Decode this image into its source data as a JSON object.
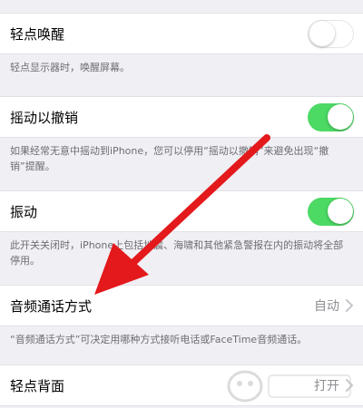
{
  "settings": {
    "tap_to_wake": {
      "label": "轻点唤醒",
      "toggle": "off",
      "footer": "轻点显示器时，唤醒屏幕。"
    },
    "shake_to_undo": {
      "label": "摇动以撤销",
      "toggle": "on",
      "footer": "如果经常无意中摇动到iPhone，您可以停用“摇动以撤销”来避免出现“撤销”提醒。"
    },
    "vibration": {
      "label": "振动",
      "toggle": "on",
      "footer": "此开关关闭时，iPhone上包括地震、海啸和其他紧急警报在内的振动将全部停用。"
    },
    "call_audio_routing": {
      "label": "音频通话方式",
      "value": "自动",
      "footer": "“音频通话方式”可决定用哪种方式接听电话或FaceTime音频通话。"
    },
    "back_tap": {
      "label": "轻点背面",
      "value": "打开"
    }
  },
  "icons": {
    "chevron": "chevron-right-icon",
    "annotation": "red-arrow-icon"
  },
  "colors": {
    "toggle_on": "#4cd964",
    "background": "#efeff4",
    "annotation_arrow": "#e3191b"
  }
}
